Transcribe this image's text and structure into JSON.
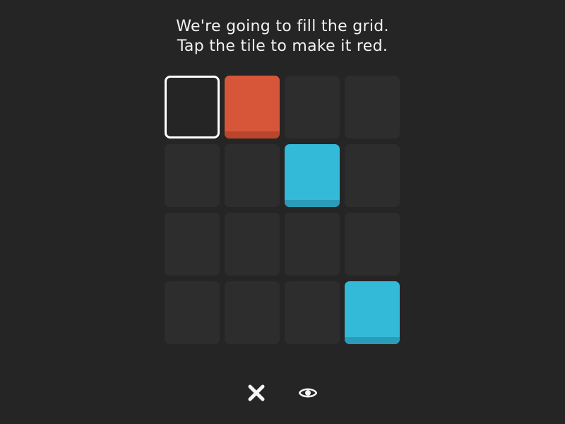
{
  "instructions": {
    "line1": "We're going to fill the grid.",
    "line2": "Tap the tile to make it red."
  },
  "colors": {
    "background": "#252525",
    "empty_tile": "#2d2d2d",
    "red": "#d75538",
    "blue": "#33bad9",
    "selected_border": "#ffffff"
  },
  "grid": {
    "rows": 4,
    "cols": 4,
    "tiles": [
      [
        "selected",
        "red",
        "empty",
        "empty"
      ],
      [
        "empty",
        "empty",
        "blue",
        "empty"
      ],
      [
        "empty",
        "empty",
        "empty",
        "empty"
      ],
      [
        "empty",
        "empty",
        "empty",
        "blue"
      ]
    ]
  },
  "controls": {
    "close_icon": "close-icon",
    "eye_icon": "eye-icon"
  }
}
